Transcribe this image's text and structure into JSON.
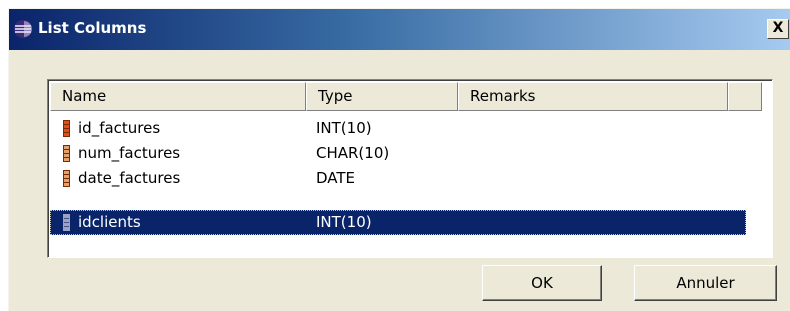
{
  "window": {
    "title": "List Columns",
    "close_label": "X"
  },
  "table": {
    "columns": [
      "Name",
      "Type",
      "Remarks"
    ],
    "rows": [
      {
        "name": "id_factures",
        "type": "INT(10)",
        "remarks": "",
        "icon": "primary-key-column-icon"
      },
      {
        "name": "num_factures",
        "type": "CHAR(10)",
        "remarks": "",
        "icon": "column-icon"
      },
      {
        "name": "date_factures",
        "type": "DATE",
        "remarks": "",
        "icon": "column-icon"
      },
      {
        "name": "idclients",
        "type": "INT(10)",
        "remarks": "",
        "icon": "column-icon",
        "selected": true
      }
    ],
    "selection_color": "#0a246a"
  },
  "buttons": {
    "ok_label": "OK",
    "cancel_label": "Annuler"
  },
  "colors": {
    "titlebar_start": "#0a246a",
    "titlebar_end": "#a6caf0",
    "dialog_bg": "#ece9d8"
  }
}
